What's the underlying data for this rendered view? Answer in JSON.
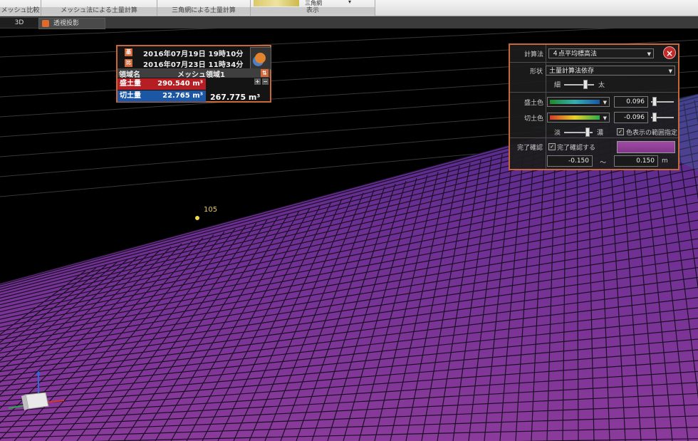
{
  "ribbon": {
    "groups": [
      {
        "label": "メッシュ比較"
      },
      {
        "label": "メッシュ法による土量計算"
      },
      {
        "label": "三角網による土量計算"
      },
      {
        "label": "表示"
      }
    ],
    "tiny_text": "三角網"
  },
  "tabs": [
    {
      "label": "3D"
    },
    {
      "label": "透視投影"
    }
  ],
  "viewport": {
    "point_label": "105",
    "mesh_color": "#8a3a9a"
  },
  "info_panel": {
    "badge_from": "基",
    "badge_to": "比",
    "date_from": "2016年07月19日 19時10分",
    "date_to": "2016年07月23日 11時34分",
    "header_label": "領域名",
    "header_area": "メッシュ領域1",
    "fill_label": "盛土量",
    "fill_value": "290.540 m³",
    "cut_label": "切土量",
    "cut_value": "22.765 m³",
    "total_value": "267.775 m³",
    "colors": {
      "fill": "#b51f24",
      "cut": "#1c57a6",
      "border": "#c8673a"
    }
  },
  "settings_panel": {
    "calc_method_label": "計算法",
    "calc_method_value": "４点平均標高法",
    "shape_label": "形状",
    "shape_value": "土量計算法依存",
    "thin_label": "細",
    "thick_label": "太",
    "fill_color_label": "盛土色",
    "fill_value": "0.096",
    "cut_color_label": "切土色",
    "cut_value": "-0.096",
    "light_label": "淡",
    "dark_label": "濃",
    "range_check_label": "色表示の範囲指定",
    "complete_label": "完了確認",
    "complete_check_label": "完了確認する",
    "range_min": "-0.150",
    "range_sep": "～",
    "range_max": "0.150",
    "unit": "m",
    "check_mark": "✓",
    "close_icon": "×"
  }
}
